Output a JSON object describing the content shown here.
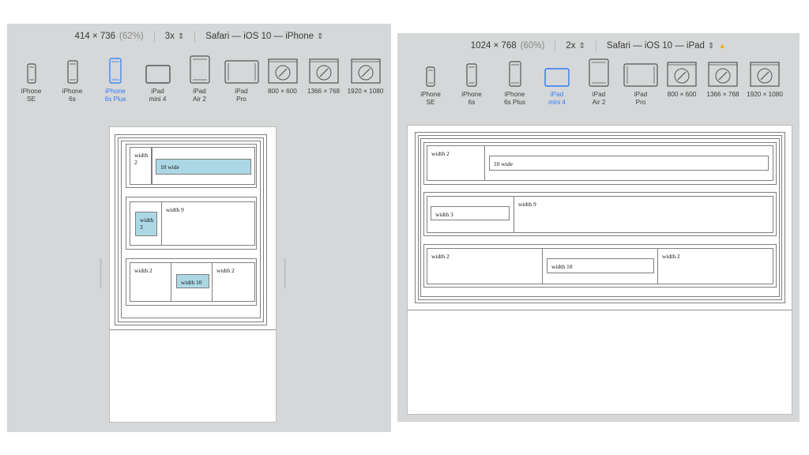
{
  "left": {
    "toolbar": {
      "dimensions": "414 × 736",
      "percent": "(62%)",
      "scale": "3x",
      "browser": "Safari — iOS 10 — iPhone"
    },
    "devices": [
      {
        "label": "iPhone\nSE",
        "icon": "phone-small-icon",
        "active": false
      },
      {
        "label": "iPhone\n6s",
        "icon": "phone-icon",
        "active": false
      },
      {
        "label": "iPhone\n6s Plus",
        "icon": "phone-large-icon",
        "active": true
      },
      {
        "label": "iPad\nmini 4",
        "icon": "tablet-landscape-icon",
        "active": false
      },
      {
        "label": "iPad\nAir 2",
        "icon": "tablet-icon",
        "active": false
      },
      {
        "label": "iPad\nPro",
        "icon": "tablet-large-icon",
        "active": false
      },
      {
        "label": "800 × 600",
        "icon": "compass-icon",
        "active": false
      },
      {
        "label": "1366 × 768",
        "icon": "compass-icon",
        "active": false
      },
      {
        "label": "1920 × 1080",
        "icon": "compass-icon",
        "active": false
      }
    ],
    "preview": {
      "row1": {
        "cell1": "width 2",
        "cell2": "10 wide"
      },
      "row2": {
        "cell1": "width 3",
        "cell2": "width 9"
      },
      "row3": {
        "cell1": "width 2",
        "cell2": "width 10",
        "cell3": "width 2"
      }
    }
  },
  "right": {
    "toolbar": {
      "dimensions": "1024 × 768",
      "percent": "(60%)",
      "scale": "2x",
      "browser": "Safari — iOS 10 — iPad"
    },
    "devices": [
      {
        "label": "iPhone\nSE",
        "icon": "phone-small-icon",
        "active": false
      },
      {
        "label": "iPhone\n6s",
        "icon": "phone-icon",
        "active": false
      },
      {
        "label": "iPhone\n6s Plus",
        "icon": "phone-large-icon",
        "active": false
      },
      {
        "label": "iPad\nmini 4",
        "icon": "tablet-landscape-icon",
        "active": true
      },
      {
        "label": "iPad\nAir 2",
        "icon": "tablet-icon",
        "active": false
      },
      {
        "label": "iPad\nPro",
        "icon": "tablet-large-icon",
        "active": false
      },
      {
        "label": "800 × 600",
        "icon": "compass-icon",
        "active": false
      },
      {
        "label": "1366 × 768",
        "icon": "compass-icon",
        "active": false
      },
      {
        "label": "1920 × 1080",
        "icon": "compass-icon",
        "active": false
      }
    ],
    "preview": {
      "row1": {
        "cell1": "width 2",
        "cell2": "10 wide"
      },
      "row2": {
        "cell1": "width 3",
        "cell2": "width 9"
      },
      "row3": {
        "cell1": "width 2",
        "cell2": "width 10",
        "cell3": "width 2"
      }
    }
  },
  "colors": {
    "active": "#2f7bf6",
    "cell_fill": "#acd8e5",
    "warning": "#e5b12b"
  }
}
